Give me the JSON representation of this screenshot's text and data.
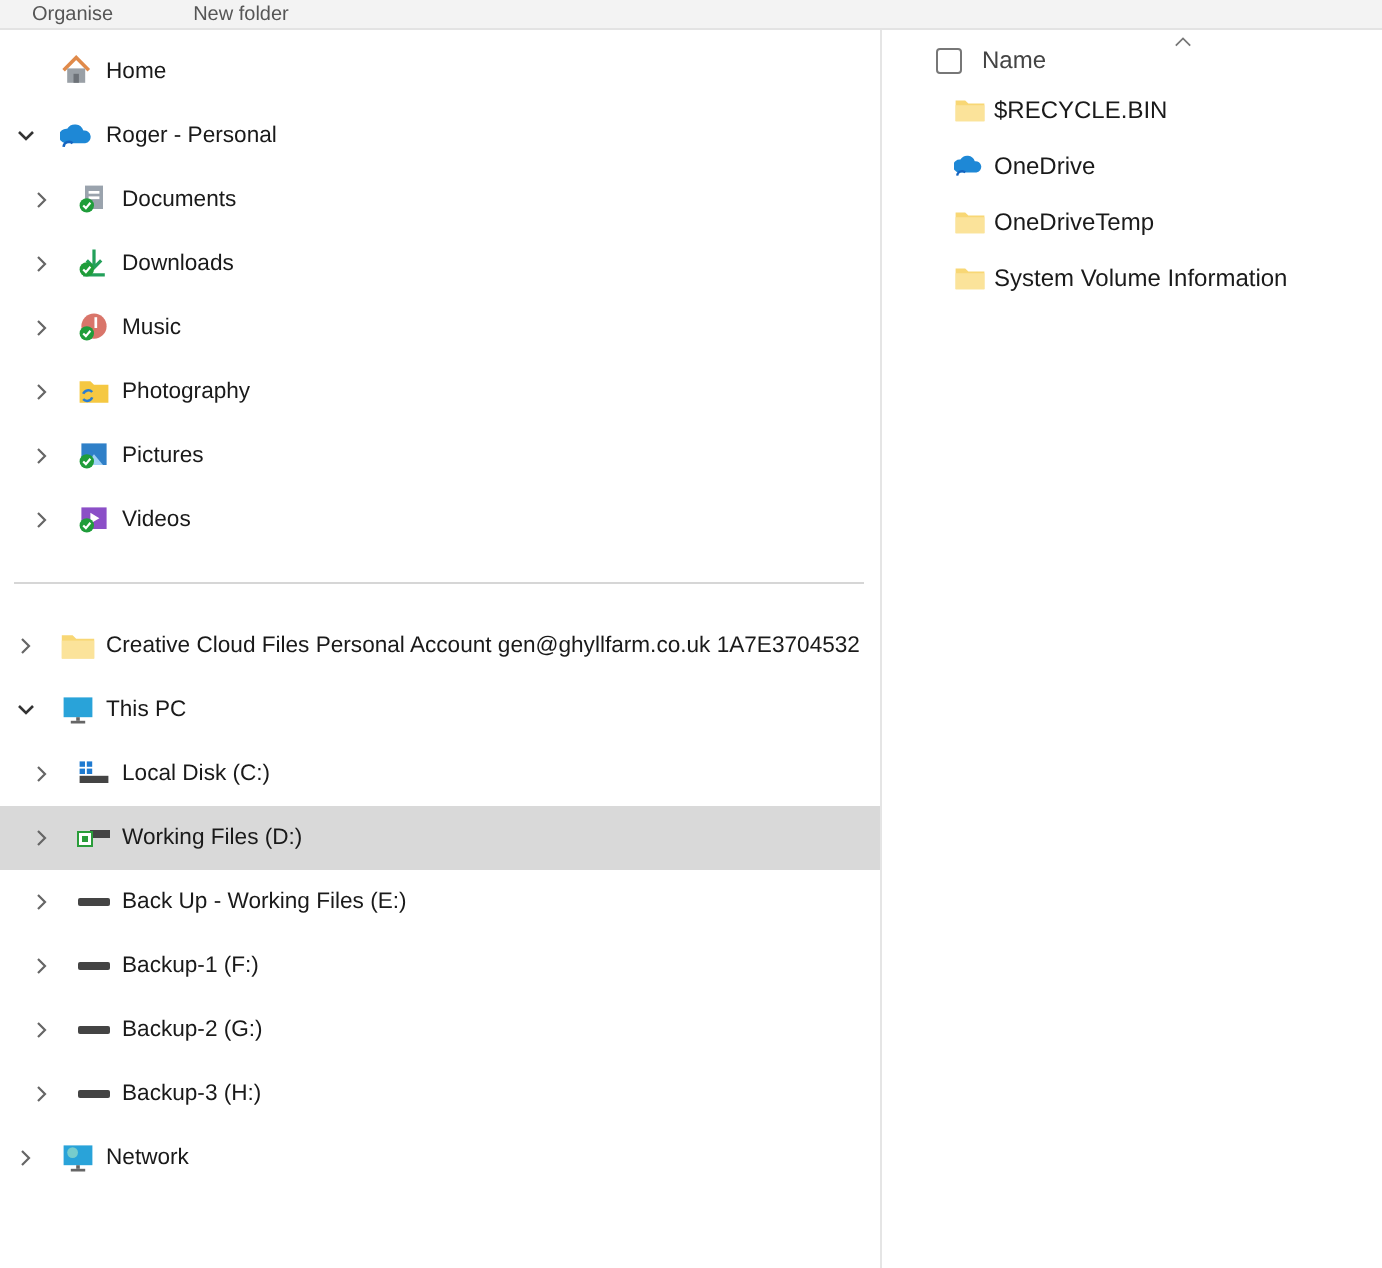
{
  "toolbar": {
    "items": [
      "Organise",
      "New folder"
    ]
  },
  "navigation": {
    "sections": [
      [
        {
          "label": "Home",
          "selected": false
        },
        {
          "label": "Roger - Personal",
          "expanded": true,
          "selected": false,
          "children": [
            {
              "label": "Documents",
              "expanded": false,
              "selected": false
            },
            {
              "label": "Downloads",
              "expanded": false,
              "selected": false
            },
            {
              "label": "Music",
              "expanded": false,
              "selected": false
            },
            {
              "label": "Photography",
              "expanded": false,
              "selected": false
            },
            {
              "label": "Pictures",
              "expanded": false,
              "selected": false
            },
            {
              "label": "Videos",
              "expanded": false,
              "selected": false
            }
          ]
        }
      ],
      [
        {
          "label": "Creative Cloud Files Personal Account gen@ghyllfarm.co.uk 1A7E3704532",
          "expanded": false,
          "selected": false
        },
        {
          "label": "This PC",
          "expanded": true,
          "selected": false,
          "children": [
            {
              "label": "Local Disk (C:)",
              "expanded": false,
              "selected": false
            },
            {
              "label": "Working Files (D:)",
              "expanded": false,
              "selected": true
            },
            {
              "label": "Back Up - Working Files (E:)",
              "expanded": false,
              "selected": false
            },
            {
              "label": "Backup-1 (F:)",
              "expanded": false,
              "selected": false
            },
            {
              "label": "Backup-2 (G:)",
              "expanded": false,
              "selected": false
            },
            {
              "label": "Backup-3 (H:)",
              "expanded": false,
              "selected": false
            }
          ]
        },
        {
          "label": "Network",
          "expanded": false,
          "selected": false
        }
      ]
    ]
  },
  "files": {
    "select_all": {
      "checked": false
    },
    "column": "Name",
    "items": [
      {
        "name": "$RECYCLE.BIN",
        "kind": "folder"
      },
      {
        "name": "OneDrive",
        "kind": "cloud"
      },
      {
        "name": "OneDriveTemp",
        "kind": "folder"
      },
      {
        "name": "System Volume Information",
        "kind": "folder"
      }
    ]
  }
}
